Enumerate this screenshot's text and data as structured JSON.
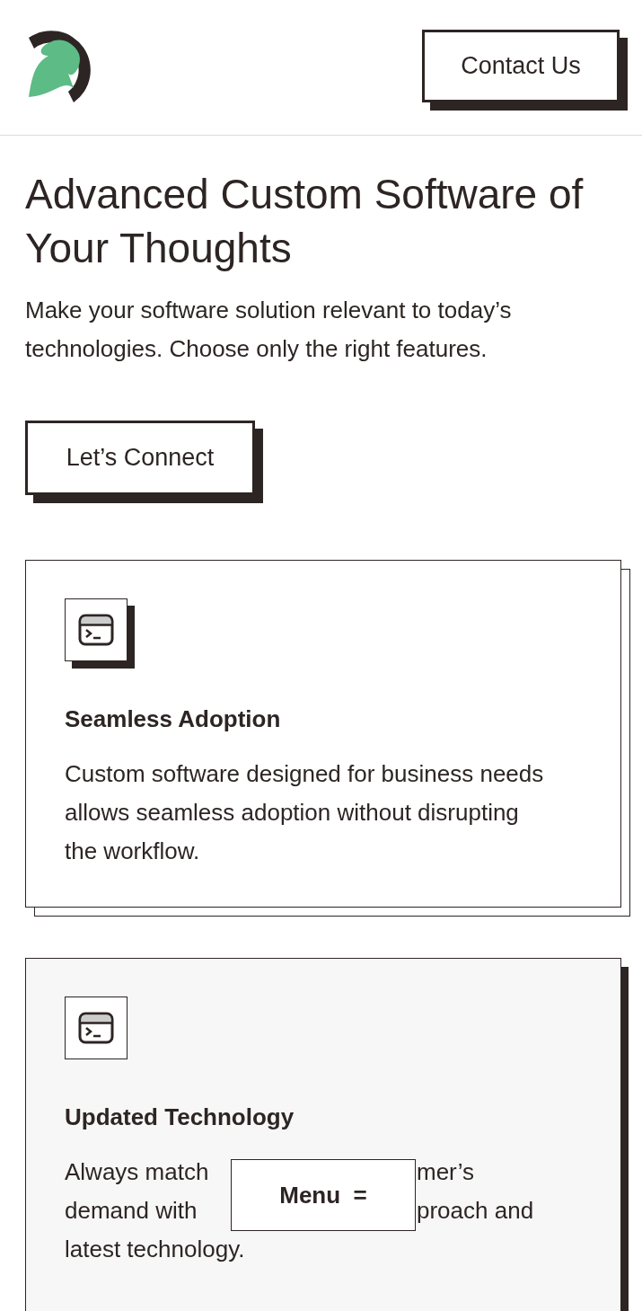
{
  "header": {
    "contact_button": "Contact Us"
  },
  "hero": {
    "title": "Advanced Custom Software of Your Thoughts",
    "subtitle": "Make your software solution relevant to today’s technologies. Choose only the right features.",
    "button": "Let’s Connect"
  },
  "cards": [
    {
      "kind": "outlined",
      "title": "Seamless Adoption",
      "lines": [
        {
          "left": "Custom software designed for business needs allows seamless adoption without disrupting the workflow."
        }
      ]
    },
    {
      "kind": "shaded",
      "title": "Updated Technology",
      "lines": [
        {
          "left": "Always match",
          "right": "mer’s"
        },
        {
          "left": "demand with",
          "right": "proach and"
        },
        {
          "left": "latest technology."
        }
      ]
    }
  ],
  "menu_button": {
    "label": "Menu",
    "icon": "="
  }
}
